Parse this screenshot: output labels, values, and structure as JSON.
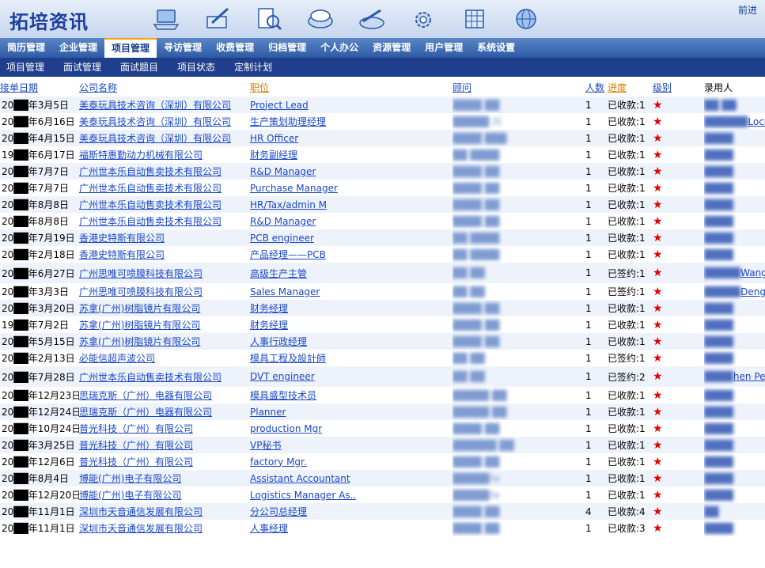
{
  "header": {
    "logo": "拓培资讯",
    "forward": "前进",
    "tool_icons": [
      "laptop-icon",
      "pen-icon",
      "search-doc-icon",
      "disk-icon",
      "tools-icon",
      "gear-icon",
      "calculator-icon",
      "globe-icon"
    ]
  },
  "nav": {
    "items": [
      "简历管理",
      "企业管理",
      "项目管理",
      "寻访管理",
      "收费管理",
      "归档管理",
      "个人办公",
      "资源管理",
      "用户管理",
      "系统设置"
    ],
    "active_index": 2
  },
  "subnav": {
    "items": [
      "项目管理",
      "面试管理",
      "面试题目",
      "项目状态",
      "定制计划"
    ]
  },
  "table": {
    "headers": {
      "date": "接单日期",
      "company": "公司名称",
      "position": "职位",
      "consultant": "顾问",
      "count": "人数",
      "progress": "进度",
      "level": "级别",
      "hired": "录用人"
    },
    "rows": [
      {
        "date": "20██年3月5日",
        "company": "美泰玩具技术咨询（深圳）有限公司",
        "position": "Project Lead",
        "consultant": "████ ██",
        "count": "1",
        "progress": "已收款:1",
        "star": "★",
        "hired": "██ ██",
        "hired_text": ""
      },
      {
        "date": "20██年6月16日",
        "company": "美泰玩具技术咨询（深圳）有限公司",
        "position": "生产策划助理经理",
        "consultant": "█████ 刘",
        "count": "1",
        "progress": "已收款:1",
        "star": "★",
        "hired": "██████",
        "hired_text": "Locky C"
      },
      {
        "date": "20██年4月15日",
        "company": "美泰玩具技术咨询（深圳）有限公司",
        "position": "HR Officer",
        "consultant": "████ ███",
        "count": "1",
        "progress": "已收款:1",
        "star": "★",
        "hired": "████",
        "hired_text": ""
      },
      {
        "date": "19██年6月17日",
        "company": "福斯特惠勤动力机械有限公司",
        "position": "财务副经理",
        "consultant": "██ ████",
        "count": "1",
        "progress": "已收款:1",
        "star": "★",
        "hired": "████",
        "hired_text": ""
      },
      {
        "date": "20██年7月7日",
        "company": "广州世本乐自动售卖技术有限公司",
        "position": "R&D Manager",
        "consultant": "████ ██",
        "count": "1",
        "progress": "已收款:1",
        "star": "★",
        "hired": "████",
        "hired_text": ""
      },
      {
        "date": "20██年7月7日",
        "company": "广州世本乐自动售卖技术有限公司",
        "position": "Purchase Manager",
        "consultant": "████ ██",
        "count": "1",
        "progress": "已收款:1",
        "star": "★",
        "hired": "████",
        "hired_text": ""
      },
      {
        "date": "20██年8月8日",
        "company": "广州世本乐自动售卖技术有限公司",
        "position": "HR/Tax/admin M",
        "consultant": "████ ██",
        "count": "1",
        "progress": "已收款:1",
        "star": "★",
        "hired": "████",
        "hired_text": ""
      },
      {
        "date": "20██年8月8日",
        "company": "广州世本乐自动售卖技术有限公司",
        "position": "R&D Manager",
        "consultant": "████ ██",
        "count": "1",
        "progress": "已收款:1",
        "star": "★",
        "hired": "████",
        "hired_text": ""
      },
      {
        "date": "20██年7月19日",
        "company": "香港史特斯有限公司",
        "position": "PCB engineer",
        "consultant": "██ ████",
        "count": "1",
        "progress": "已收款:1",
        "star": "★",
        "hired": "████",
        "hired_text": ""
      },
      {
        "date": "20██年2月18日",
        "company": "香港史特斯有限公司",
        "position": "产品经理——PCB",
        "consultant": "██ ████",
        "count": "1",
        "progress": "已收款:1",
        "star": "★",
        "hired": "████",
        "hired_text": ""
      },
      {
        "date": "20██年6月27日",
        "company": "广州思唯可喷膜科技有限公司",
        "position": "高级生产主管",
        "consultant": "██ ██",
        "count": "1",
        "progress": "已签约:1",
        "star": "★",
        "hired": "█████",
        "hired_text": "Wang"
      },
      {
        "date": "20██年3月3日",
        "company": "广州思唯可喷膜科技有限公司",
        "position": "Sales Manager",
        "consultant": "██ ██",
        "count": "1",
        "progress": "已签约:1",
        "star": "★",
        "hired": "█████",
        "hired_text": "Deng X"
      },
      {
        "date": "20██年3月20日",
        "company": "苏拿(广州)树脂镜片有限公司",
        "position": "财务经理",
        "consultant": "████ ██",
        "count": "1",
        "progress": "已收款:1",
        "star": "★",
        "hired": "████",
        "hired_text": ""
      },
      {
        "date": "19██年7月2日",
        "company": "苏拿(广州)树脂镜片有限公司",
        "position": "财务经理",
        "consultant": "████ ██",
        "count": "1",
        "progress": "已收款:1",
        "star": "★",
        "hired": "████",
        "hired_text": ""
      },
      {
        "date": "20██年5月15日",
        "company": "苏拿(广州)树脂镜片有限公司",
        "position": "人事行政经理",
        "consultant": "████ ██",
        "count": "1",
        "progress": "已收款:1",
        "star": "★",
        "hired": "████",
        "hired_text": ""
      },
      {
        "date": "20██年2月13日",
        "company": "必能信超声波公司",
        "position": "模具工程及設計師",
        "consultant": "██ ██",
        "count": "1",
        "progress": "已签约:1",
        "star": "★",
        "hired": "████",
        "hired_text": ""
      },
      {
        "date": "20██年7月28日",
        "company": "广州世本乐自动售卖技术有限公司",
        "position": "DVT engineer",
        "consultant": "██ ██",
        "count": "1",
        "progress": "已签约:2",
        "star": "★",
        "hired": "████",
        "hired_text": "hen Pei"
      },
      {
        "date": "20██年12月23日",
        "company": "思瑞克斯（广州）电器有限公司",
        "position": "模具盛型技术员",
        "consultant": "█████ ██",
        "count": "1",
        "progress": "已收款:1",
        "star": "★",
        "hired": "████",
        "hired_text": ""
      },
      {
        "date": "20██年12月24日",
        "company": "思瑞克斯（广州）电器有限公司",
        "position": "Planner",
        "consultant": "█████ ██",
        "count": "1",
        "progress": "已收款:1",
        "star": "★",
        "hired": "████",
        "hired_text": ""
      },
      {
        "date": "20██年10月24日",
        "company": "普光科技（广州）有限公司",
        "position": "production Mgr",
        "consultant": "████ ██",
        "count": "1",
        "progress": "已收款:1",
        "star": "★",
        "hired": "████",
        "hired_text": ""
      },
      {
        "date": "20██年3月25日",
        "company": "普光科技（广州）有限公司",
        "position": "VP秘书",
        "consultant": "██████ ██",
        "count": "1",
        "progress": "已收款:1",
        "star": "★",
        "hired": "████",
        "hired_text": ""
      },
      {
        "date": "20██年12月6日",
        "company": "普光科技（广州）有限公司",
        "position": "factory Mgr.",
        "consultant": "████ ██",
        "count": "1",
        "progress": "已收款:1",
        "star": "★",
        "hired": "████",
        "hired_text": ""
      },
      {
        "date": "20██年8月4日",
        "company": "博能(广州)电子有限公司",
        "position": "Assistant Accountant",
        "consultant": "█████lle",
        "count": "1",
        "progress": "已收款:1",
        "star": "★",
        "hired": "████",
        "hired_text": ""
      },
      {
        "date": "20██年12月20日",
        "company": "博能(广州)电子有限公司",
        "position": "Logistics Manager As..",
        "consultant": "█████lle",
        "count": "1",
        "progress": "已收款:1",
        "star": "★",
        "hired": "████",
        "hired_text": ""
      },
      {
        "date": "20██年11月1日",
        "company": "深圳市天音通信发展有限公司",
        "position": "分公司总经理",
        "consultant": "████ ██",
        "count": "4",
        "progress": "已收款:4",
        "star": "★",
        "hired": "██",
        "hired_text": ""
      },
      {
        "date": "20██年11月1日",
        "company": "深圳市天音通信发展有限公司",
        "position": "人事经理",
        "consultant": "████ ██",
        "count": "1",
        "progress": "已收款:3",
        "star": "★",
        "hired": "████",
        "hired_text": ""
      }
    ]
  }
}
